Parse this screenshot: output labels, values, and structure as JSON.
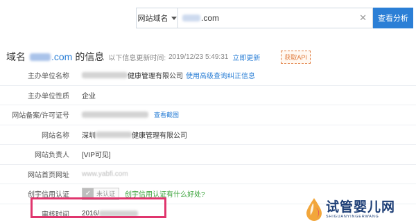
{
  "search": {
    "select_label": "网站域名",
    "input_suffix": "com",
    "button_label": "查看分析"
  },
  "header": {
    "title_prefix": "域名",
    "domain_suffix": ".com",
    "title_suffix": "的信息",
    "update_label": "以下信息更新时间:",
    "update_time": "2019/12/23 5:49:31",
    "refresh_label": "立即更新",
    "api_label": "获取API"
  },
  "rows": [
    {
      "label": "主办单位名称",
      "value": "健康管理有限公司",
      "link": "使用高级查询纠正信息"
    },
    {
      "label": "主办单位性质",
      "value": "企业"
    },
    {
      "label": "网站备案/许可证号",
      "link": "查看截图"
    },
    {
      "label": "网站名称",
      "value_prefix": "深圳",
      "value": "健康管理有限公司"
    },
    {
      "label": "网站负责人",
      "value": "[VIP可见]"
    },
    {
      "label": "网站首页网址",
      "value": "www.yabfi.com"
    },
    {
      "label": "创宇信用认证",
      "badge": "未认证",
      "link": "创宇信用认证有什么好处?"
    },
    {
      "label": "审核时间",
      "value": "2016/"
    }
  ],
  "logo": {
    "cn": "试管婴儿网",
    "en": "SHIGUANYINGERWANG"
  },
  "colors": {
    "accent": "#2b7fd6",
    "highlight": "#e0356d",
    "api": "#e07a3b",
    "green": "#3aa33a"
  }
}
